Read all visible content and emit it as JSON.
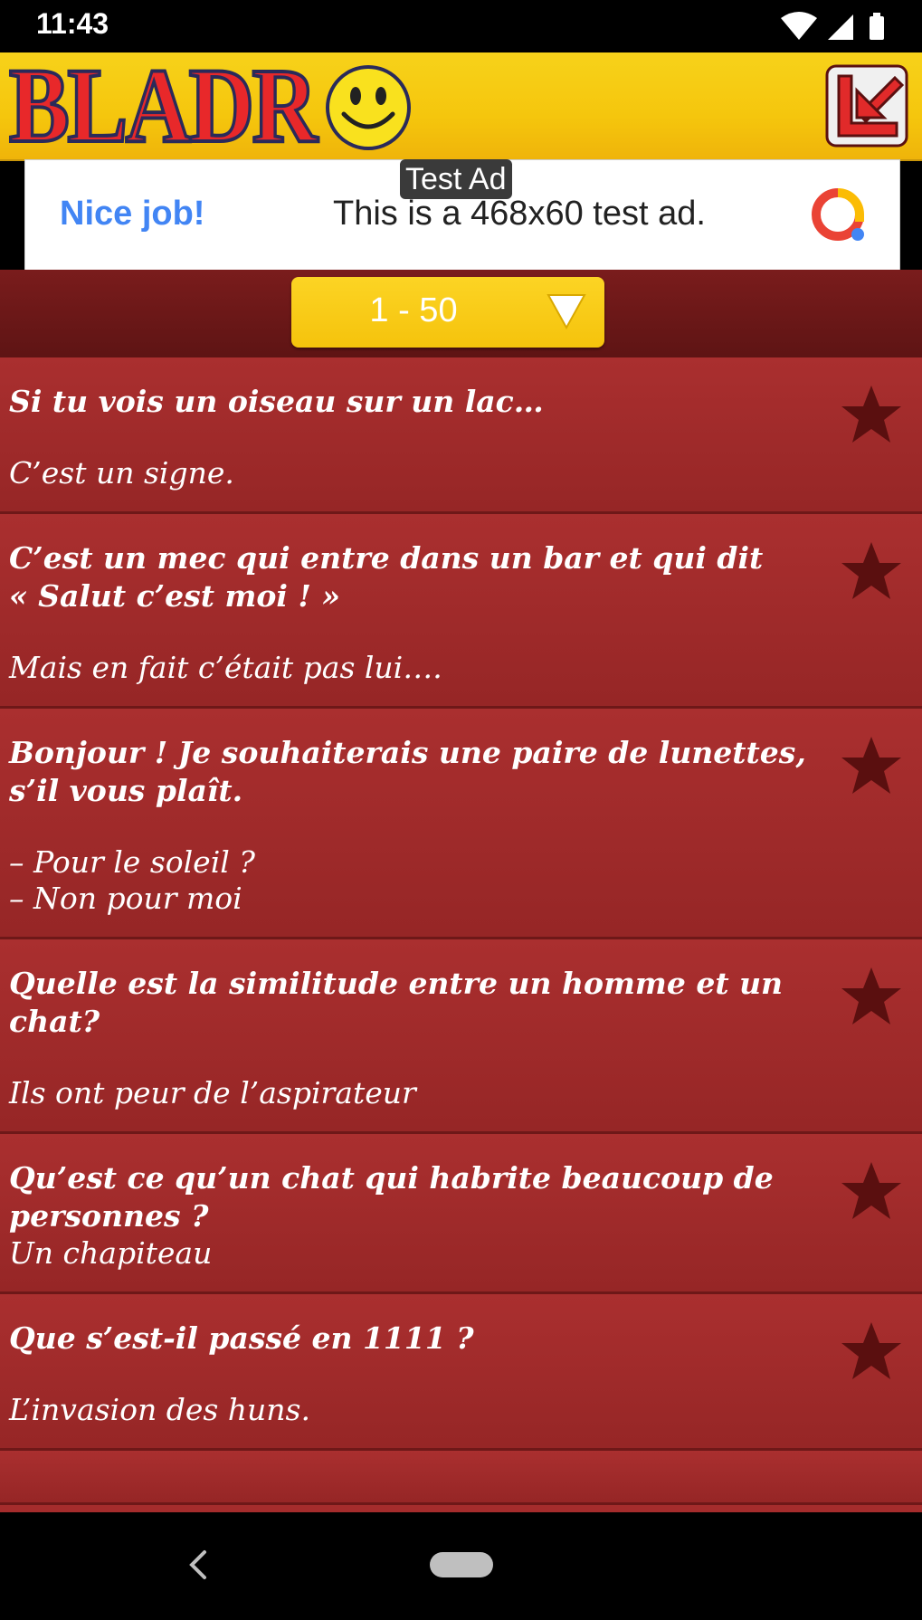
{
  "status_bar": {
    "time": "11:43"
  },
  "header": {
    "logo_text": "BLADR"
  },
  "ad": {
    "label": "Test Ad",
    "headline": "Nice job!",
    "text": "This is a 468x60 test ad."
  },
  "pager": {
    "selected": "1 - 50"
  },
  "jokes": [
    {
      "question": "Si tu vois un oiseau sur un lac…",
      "answer": "C’est un signe."
    },
    {
      "question": "C’est un mec qui entre dans un bar et qui dit\n« Salut c’est moi ! »",
      "answer": "Mais en fait c’était pas lui…."
    },
    {
      "question": "Bonjour ! Je souhaiterais une paire de lunettes,\ns’il vous plaît.",
      "answer": "– Pour le soleil ?\n– Non pour moi"
    },
    {
      "question": "Quelle est la similitude entre un homme et un\nchat?",
      "answer": "Ils ont peur de l’aspirateur"
    },
    {
      "question": "Qu’est ce qu’un chat qui habrite beaucoup de\npersonnes ?",
      "answer": "Un chapiteau"
    },
    {
      "question": "Que s’est-il passé en 1111 ?",
      "answer": "L’invasion des huns."
    }
  ],
  "icons": {
    "star": "star-icon",
    "exit": "exit-arrow-icon",
    "dropdown": "chevron-down-icon",
    "back": "back-icon",
    "home": "home-pill-icon"
  },
  "colors": {
    "header_yellow": "#f5c60d",
    "list_red": "#a52c2c",
    "logo_red": "#e8282a",
    "star_dark": "#5a0f0f"
  }
}
